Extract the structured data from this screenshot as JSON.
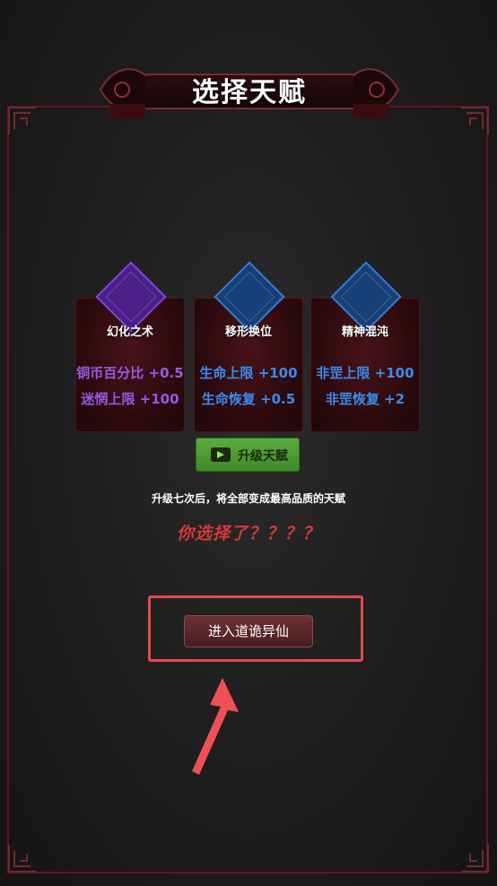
{
  "title": "选择天赋",
  "talents": [
    {
      "name": "幻化之术",
      "rarity": "purple",
      "gem_color": "#6a2bb8",
      "stats": [
        {
          "label": "铜币百分比",
          "value": "+0.5"
        },
        {
          "label": "迷惘上限",
          "value": "+100"
        }
      ]
    },
    {
      "name": "移形换位",
      "rarity": "blue",
      "gem_color": "#1e5aa6",
      "stats": [
        {
          "label": "生命上限",
          "value": "+100"
        },
        {
          "label": "生命恢复",
          "value": "+0.5"
        }
      ]
    },
    {
      "name": "精神混沌",
      "rarity": "blue",
      "gem_color": "#1e5aa6",
      "stats": [
        {
          "label": "非罡上限",
          "value": "+100"
        },
        {
          "label": "非罡恢复",
          "value": "+2"
        }
      ]
    }
  ],
  "upgrade_button": {
    "label": "升级天赋",
    "icon": "video-camera-icon"
  },
  "hint": "升级七次后，将全部变成最高品质的天赋",
  "chosen_text": "你选择了？？？？",
  "enter_button": {
    "label": "进入道诡异仙"
  },
  "colors": {
    "highlight": "#e8484c",
    "purple": "#9a58e8",
    "blue": "#3a8cf0",
    "accent_red": "#d8383b"
  }
}
